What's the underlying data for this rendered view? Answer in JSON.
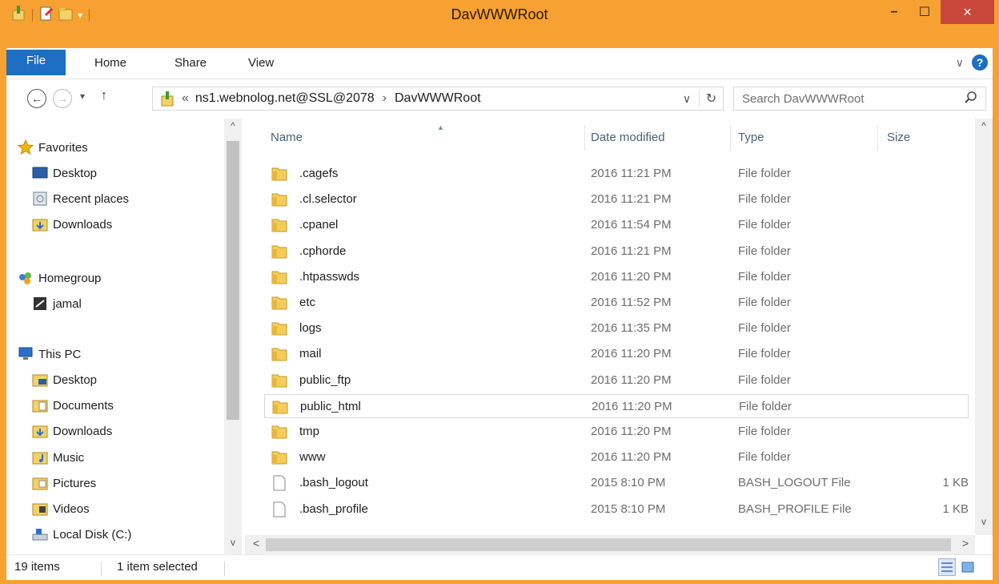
{
  "window": {
    "title": "DavWWWRoot",
    "accent": "#f6a131",
    "close_glyph": "×",
    "minimize_glyph": "–",
    "maximize_glyph": "☐"
  },
  "ribbon": {
    "tabs": [
      "File",
      "Home",
      "Share",
      "View"
    ],
    "help_glyph": "?",
    "expand_glyph": "∨"
  },
  "address": {
    "back_glyph": "←",
    "forward_glyph": "→",
    "recent_glyph": "▾",
    "up_glyph": "↑",
    "overflow": "«",
    "segments": [
      "ns1.webnolog.net@SSL@2078",
      "DavWWWRoot"
    ],
    "chevron": "›",
    "dropdown_glyph": "∨",
    "refresh_glyph": "↻"
  },
  "search": {
    "placeholder": "Search DavWWWRoot",
    "icon": "search-icon"
  },
  "nav": {
    "items": [
      {
        "label": "Favorites",
        "icon": "star-icon"
      },
      {
        "label": "Desktop",
        "icon": "desktop-icon"
      },
      {
        "label": "Recent places",
        "icon": "recent-places-icon"
      },
      {
        "label": "Downloads",
        "icon": "downloads-folder-icon"
      },
      {
        "label": "Homegroup",
        "icon": "homegroup-icon"
      },
      {
        "label": "jamal",
        "icon": "user-avatar-icon"
      },
      {
        "label": "This PC",
        "icon": "computer-icon"
      },
      {
        "label": "Desktop",
        "icon": "desktop-folder-icon"
      },
      {
        "label": "Documents",
        "icon": "documents-folder-icon"
      },
      {
        "label": "Downloads",
        "icon": "downloads-folder-icon"
      },
      {
        "label": "Music",
        "icon": "music-folder-icon"
      },
      {
        "label": "Pictures",
        "icon": "pictures-folder-icon"
      },
      {
        "label": "Videos",
        "icon": "videos-folder-icon"
      },
      {
        "label": "Local Disk (C:)",
        "icon": "disk-icon"
      }
    ]
  },
  "columns": [
    "Name",
    "Date modified",
    "Type",
    "Size"
  ],
  "files": [
    {
      "name": ".cagefs",
      "date": "2016 11:21 PM",
      "type": "File folder",
      "size": "",
      "kind": "folder"
    },
    {
      "name": ".cl.selector",
      "date": "2016 11:21 PM",
      "type": "File folder",
      "size": "",
      "kind": "folder"
    },
    {
      "name": ".cpanel",
      "date": "2016 11:54 PM",
      "type": "File folder",
      "size": "",
      "kind": "folder"
    },
    {
      "name": ".cphorde",
      "date": "2016 11:21 PM",
      "type": "File folder",
      "size": "",
      "kind": "folder"
    },
    {
      "name": ".htpasswds",
      "date": "2016 11:20 PM",
      "type": "File folder",
      "size": "",
      "kind": "folder"
    },
    {
      "name": "etc",
      "date": "2016 11:52 PM",
      "type": "File folder",
      "size": "",
      "kind": "folder"
    },
    {
      "name": "logs",
      "date": "2016 11:35 PM",
      "type": "File folder",
      "size": "",
      "kind": "folder"
    },
    {
      "name": "mail",
      "date": "2016 11:20 PM",
      "type": "File folder",
      "size": "",
      "kind": "folder"
    },
    {
      "name": "public_ftp",
      "date": "2016 11:20 PM",
      "type": "File folder",
      "size": "",
      "kind": "folder"
    },
    {
      "name": "public_html",
      "date": "2016 11:20 PM",
      "type": "File folder",
      "size": "",
      "kind": "folder",
      "selected": true
    },
    {
      "name": "tmp",
      "date": "2016 11:20 PM",
      "type": "File folder",
      "size": "",
      "kind": "folder"
    },
    {
      "name": "www",
      "date": "2016 11:20 PM",
      "type": "File folder",
      "size": "",
      "kind": "folder"
    },
    {
      "name": ".bash_logout",
      "date": "2015 8:10 PM",
      "type": "BASH_LOGOUT File",
      "size": "1 KB",
      "kind": "file"
    },
    {
      "name": ".bash_profile",
      "date": "2015 8:10 PM",
      "type": "BASH_PROFILE File",
      "size": "1 KB",
      "kind": "file"
    }
  ],
  "status": {
    "items_count": "19 items",
    "selection": "1 item selected"
  },
  "scroll": {
    "up_glyph": "^",
    "down_glyph": "v",
    "left_glyph": "<",
    "right_glyph": ">"
  }
}
